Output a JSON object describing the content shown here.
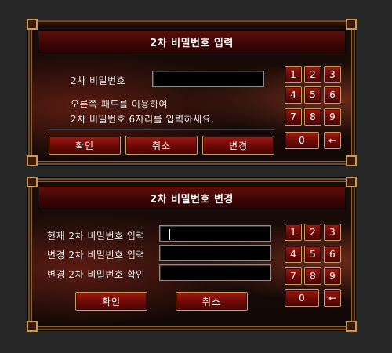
{
  "dialog1": {
    "title": "2차 비밀번호 입력",
    "password_label": "2차 비밀번호",
    "instruction_line1": "오른쪽 패드를 이용하여",
    "instruction_line2": "2차 비밀번호 6자리를 입력하세요.",
    "buttons": {
      "confirm": "확인",
      "cancel": "취소",
      "change": "변경"
    },
    "keypad": [
      "1",
      "2",
      "3",
      "4",
      "5",
      "6",
      "7",
      "8",
      "9",
      "0",
      "←"
    ]
  },
  "dialog2": {
    "title": "2차 비밀번호 변경",
    "current_label": "현재 2차 비밀번호 입력",
    "new_label": "변경 2차 비밀번호 입력",
    "confirm_label": "변경 2차 비밀번호 확인",
    "buttons": {
      "confirm": "확인",
      "cancel": "취소"
    },
    "keypad": [
      "1",
      "2",
      "3",
      "4",
      "5",
      "6",
      "7",
      "8",
      "9",
      "0",
      "←"
    ]
  },
  "colors": {
    "button_red": "#6c0a06",
    "border_gold": "#c8a064",
    "title_bg": "#3c0504"
  }
}
